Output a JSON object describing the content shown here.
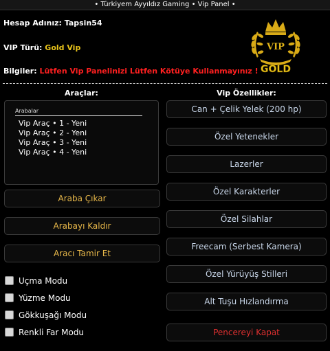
{
  "window": {
    "title": "•  Türkiyem Ayyıldız Gaming  •  Vip Panel  •"
  },
  "account": {
    "name_label": "Hesap Adınız:",
    "name_value": "Tapsin54",
    "vip_label": "VIP Türü:",
    "vip_value": "Gold Vip",
    "info_label": "Bilgiler:",
    "info_value": "Lütfen Vip Panelinizi Lütfen Kötüye Kullanmayınız !"
  },
  "logo": {
    "line1": "VIP",
    "line2": "GOLD",
    "icon": "laurel-crown-icon"
  },
  "tools": {
    "title": "Araçlar:",
    "list_header": "Arabalar",
    "vehicles": [
      "Vip Araç  •  1 - Yeni",
      "Vip Araç  •  2 - Yeni",
      "Vip Araç  •  3 - Yeni",
      "Vip Araç  •  4 - Yeni"
    ],
    "spawn_car": "Araba Çıkar",
    "remove_car": "Arabayı Kaldır",
    "repair_car": "Aracı Tamir Et"
  },
  "modes": {
    "fly": "Uçma Modu",
    "swim": "Yüzme Modu",
    "rainbow": "Gökkuşağı Modu",
    "colorful_lights": "Renkli Far Modu"
  },
  "features": {
    "title": "Vip Özellikler:",
    "health_armor": "Can + Çelik Yelek (200 hp)",
    "special_skills": "Özel Yetenekler",
    "lasers": "Lazerler",
    "special_characters": "Özel Karakterler",
    "special_weapons": "Özel Silahlar",
    "freecam": "Freecam (Serbest Kamera)",
    "special_walking": "Özel Yürüyüş Stilleri",
    "alt_speed": "Alt Tuşu Hızlandırma",
    "close_window": "Pencereyi Kapat"
  },
  "colors": {
    "gold": "#e8c31a",
    "red": "#ff2020",
    "button_text_left": "#e8b84a",
    "button_text_right": "#c9d7ea"
  }
}
